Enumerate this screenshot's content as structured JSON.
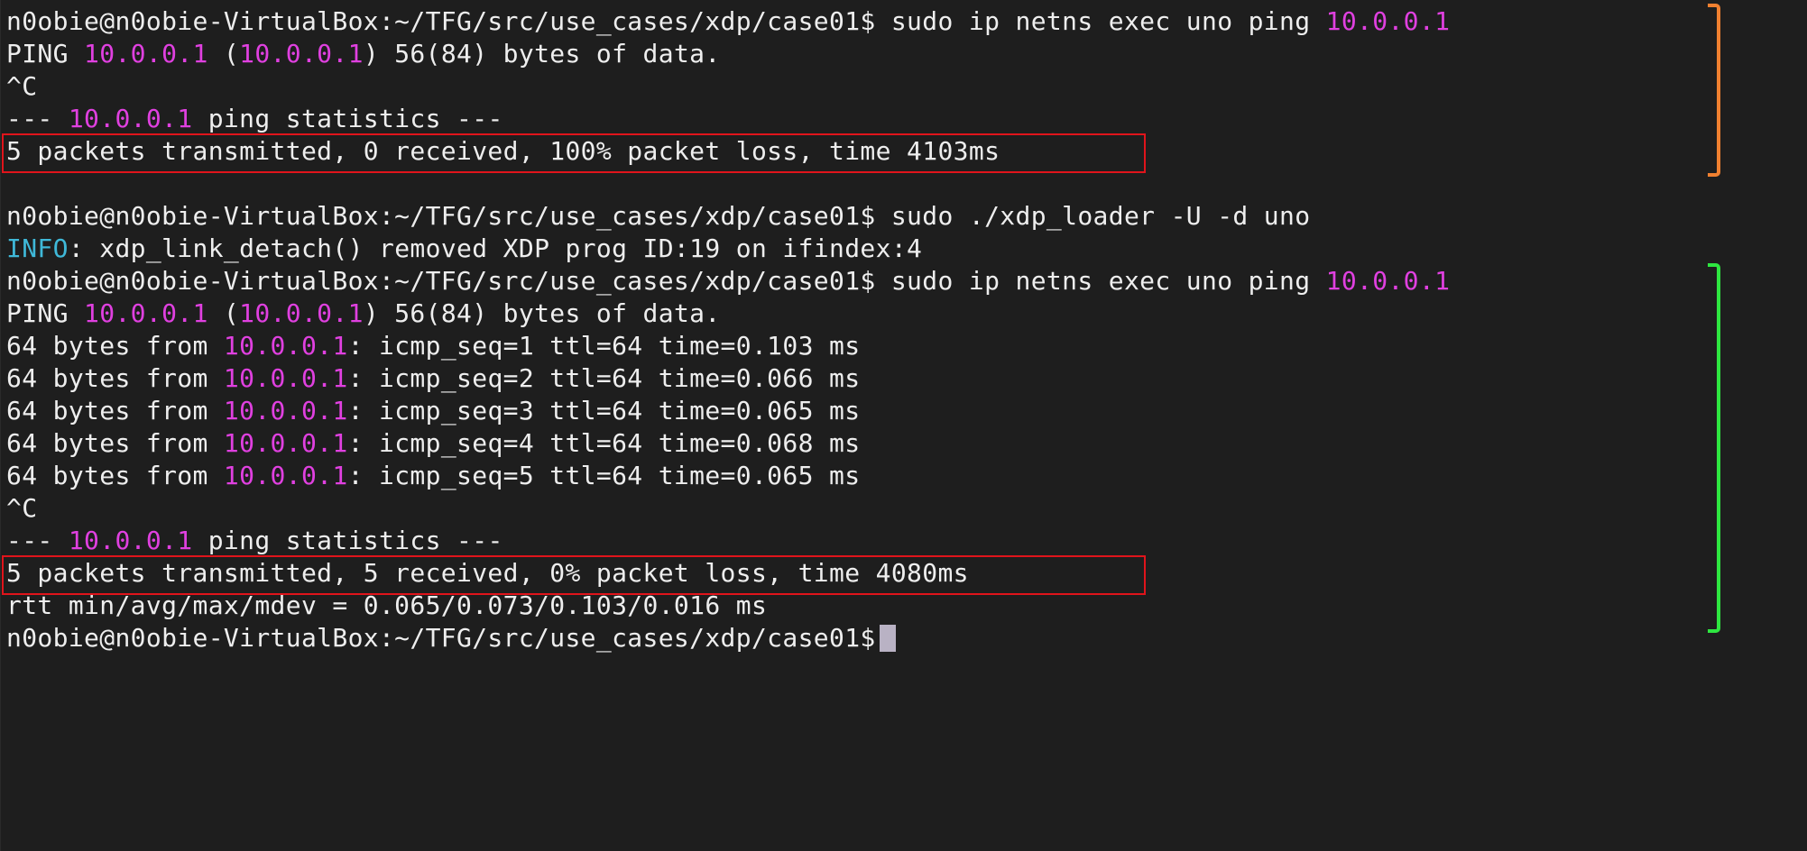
{
  "terminal": {
    "prompt": "n0obie@n0obie-VirtualBox:~/TFG/src/use_cases/xdp/case01$",
    "lines": {
      "cmd1_text": " sudo ip netns exec uno ping ",
      "cmd1_ip": "10.0.0.1",
      "ping_hdr1": {
        "prefix": "PING ",
        "ip1": "10.0.0.1",
        "mid": " (",
        "ip2": "10.0.0.1",
        "suffix": ") 56(84) bytes of data."
      },
      "ctrlc1": "^C",
      "stats1": {
        "prefix": "--- ",
        "ip": "10.0.0.1",
        "suffix": " ping statistics ---"
      },
      "result1": "5 packets transmitted, 0 received, 100% packet loss, time 4103ms",
      "cmd2_text": " sudo ./xdp_loader -U -d uno",
      "info_label": "INFO",
      "info_text": ": xdp_link_detach() removed XDP prog ID:19 on ifindex:4",
      "cmd3_text": " sudo ip netns exec uno ping ",
      "cmd3_ip": "10.0.0.1",
      "ping_hdr2": {
        "prefix": "PING ",
        "ip1": "10.0.0.1",
        "mid": " (",
        "ip2": "10.0.0.1",
        "suffix": ") 56(84) bytes of data."
      },
      "replies": [
        {
          "prefix": "64 bytes from ",
          "ip": "10.0.0.1",
          "suffix": ": icmp_seq=1 ttl=64 time=0.103 ms"
        },
        {
          "prefix": "64 bytes from ",
          "ip": "10.0.0.1",
          "suffix": ": icmp_seq=2 ttl=64 time=0.066 ms"
        },
        {
          "prefix": "64 bytes from ",
          "ip": "10.0.0.1",
          "suffix": ": icmp_seq=3 ttl=64 time=0.065 ms"
        },
        {
          "prefix": "64 bytes from ",
          "ip": "10.0.0.1",
          "suffix": ": icmp_seq=4 ttl=64 time=0.068 ms"
        },
        {
          "prefix": "64 bytes from ",
          "ip": "10.0.0.1",
          "suffix": ": icmp_seq=5 ttl=64 time=0.065 ms"
        }
      ],
      "ctrlc2": "^C",
      "stats2": {
        "prefix": "--- ",
        "ip": "10.0.0.1",
        "suffix": " ping statistics ---"
      },
      "result2": "5 packets transmitted, 5 received, 0% packet loss, time 4080ms",
      "rtt": "rtt min/avg/max/mdev = 0.065/0.073/0.103/0.016 ms"
    }
  },
  "colors": {
    "background": "#1e1e1e",
    "text": "#eeeeee",
    "ip_highlight": "#e040e0",
    "info_label": "#3fb8d8",
    "highlight_box": "#e0141b",
    "bracket_first_run": "#f08030",
    "bracket_second_run": "#2ee640",
    "cursor": "#b9b2c4"
  }
}
